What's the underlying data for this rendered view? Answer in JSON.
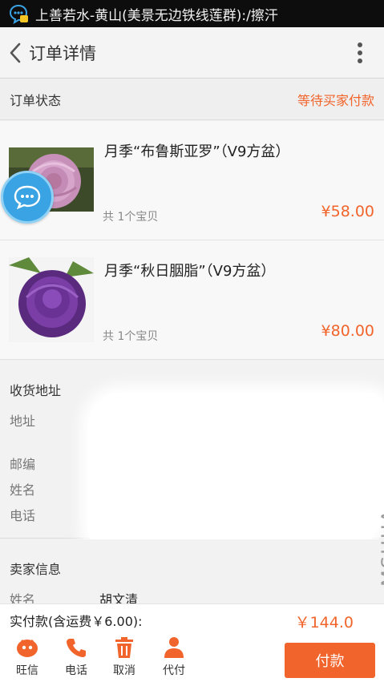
{
  "status_bar": {
    "text": "上善若水-黄山(美景无边铁线莲群):/擦汗",
    "icon": "chat-notification-icon"
  },
  "header": {
    "title": "订单详情",
    "back_icon": "chevron-left-icon",
    "more_icon": "more-vertical-icon"
  },
  "order_status": {
    "label": "订单状态",
    "value": "等待买家付款",
    "accent_color": "#f1642b"
  },
  "products": [
    {
      "name": "月季“布鲁斯亚罗”（V9方盆）",
      "quantity": "共 1个宝贝",
      "price": "¥58.00"
    },
    {
      "name": "月季“秋日胭脂”（V9方盆）",
      "quantity": "共 1个宝贝",
      "price": "¥80.00"
    }
  ],
  "address": {
    "title": "收货地址",
    "fields": [
      {
        "label": "地址",
        "value": ""
      },
      {
        "label": "邮编",
        "value": ""
      },
      {
        "label": "姓名",
        "value": ""
      },
      {
        "label": "电话",
        "value": ""
      }
    ]
  },
  "seller": {
    "title": "卖家信息",
    "name_label": "姓名",
    "name_value": "胡文清"
  },
  "payment": {
    "total_label": "实付款(含运费￥6.00):",
    "total_value": "￥144.0"
  },
  "actions": [
    {
      "label": "旺信",
      "icon": "wangxin-icon"
    },
    {
      "label": "电话",
      "icon": "phone-icon"
    },
    {
      "label": "取消",
      "icon": "trash-icon"
    },
    {
      "label": "代付",
      "icon": "person-icon"
    }
  ],
  "pay_button": {
    "label": "付款"
  },
  "watermark": "MSHUA"
}
